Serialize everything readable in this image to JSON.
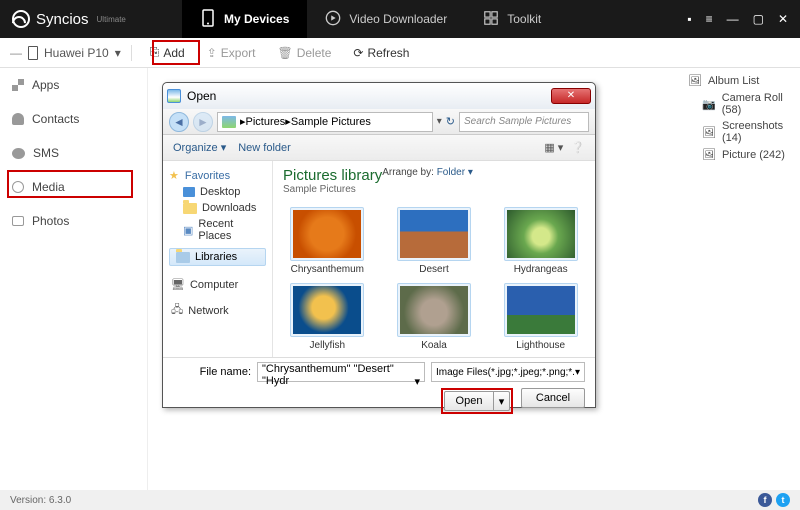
{
  "brand": "Syncios",
  "brand_sub": "Ultimate",
  "tabs": {
    "devices": "My Devices",
    "video": "Video Downloader",
    "toolkit": "Toolkit"
  },
  "device": "Huawei P10",
  "toolbar": {
    "add": "Add",
    "export": "Export",
    "delete": "Delete",
    "refresh": "Refresh"
  },
  "sidebar": {
    "apps": "Apps",
    "contacts": "Contacts",
    "sms": "SMS",
    "media": "Media",
    "photos": "Photos"
  },
  "right": {
    "head": "Album List",
    "items": [
      "Camera Roll (58)",
      "Screenshots (14)",
      "Picture (242)"
    ]
  },
  "dialog": {
    "title": "Open",
    "breadcrumb": [
      "Pictures",
      "Sample Pictures"
    ],
    "search": "Search Sample Pictures",
    "organize": "Organize",
    "newfolder": "New folder",
    "tree": {
      "favorites": "Favorites",
      "desktop": "Desktop",
      "downloads": "Downloads",
      "recent": "Recent Places",
      "libraries": "Libraries",
      "computer": "Computer",
      "network": "Network"
    },
    "lib_title": "Pictures library",
    "lib_sub": "Sample Pictures",
    "arrange_label": "Arrange by:",
    "arrange_value": "Folder",
    "thumbs": [
      "Chrysanthemum",
      "Desert",
      "Hydrangeas",
      "Jellyfish",
      "Koala",
      "Lighthouse"
    ],
    "file_label": "File name:",
    "file_value": "\"Chrysanthemum\" \"Desert\" \"Hydr",
    "filter": "Image Files(*.jpg;*.jpeg;*.png;*.",
    "open": "Open",
    "cancel": "Cancel"
  },
  "thumb_colors": {
    "Chrysanthemum": "radial-gradient(circle at 50% 50%, #e67a1a 0 40%, #c84f00 70%)",
    "Desert": "linear-gradient(#2d6fbf 0 45%, #b76b3a 45% 100%)",
    "Hydrangeas": "radial-gradient(circle at 50% 55%, #d4e88a 0 20%, #6aa84f 40%, #2d5a2d 100%)",
    "Jellyfish": "radial-gradient(circle at 45% 45%, #f2c14e 0 25%, #0a4d8c 55%)",
    "Koala": "radial-gradient(circle at 50% 55%, #b0a090 0 30%, #5d6b4a 70%)",
    "Lighthouse": "linear-gradient(#2a5fae 0 60%, #3a7a3a 60% 100%)"
  },
  "footer": {
    "version": "Version: 6.3.0"
  }
}
